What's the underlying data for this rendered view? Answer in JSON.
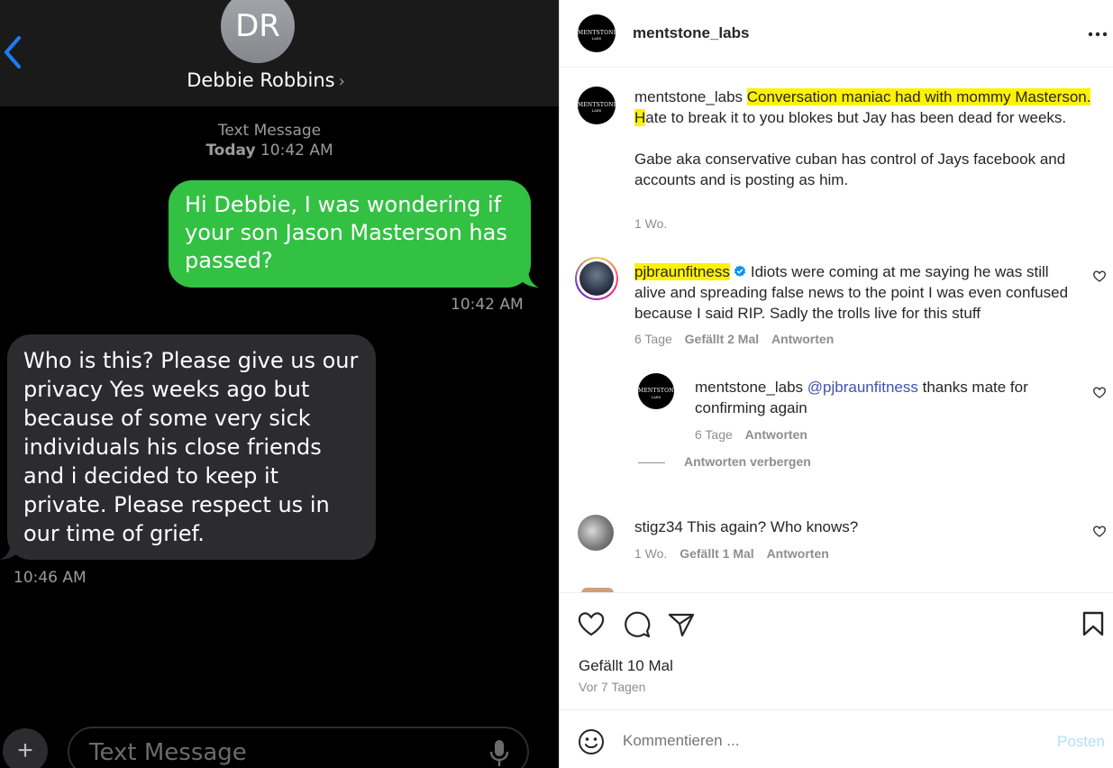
{
  "messages": {
    "contact_initials": "DR",
    "contact_name": "Debbie Robbins",
    "contact_chevron": "›",
    "meta_label": "Text Message",
    "meta_day": "Today",
    "meta_time": "10:42 AM",
    "outgoing_text": "Hi Debbie, I was wondering if your son Jason Masterson has passed?",
    "outgoing_time": "10:42 AM",
    "incoming_text": "Who is this? Please give us our privacy Yes weeks ago but because of some very sick individuals his close friends and i decided to keep it private. Please respect us in our time of grief.",
    "incoming_time": "10:46 AM",
    "add_label": "+",
    "input_placeholder": "Text Message",
    "colors": {
      "outgoing_bubble": "#33c143",
      "incoming_bubble": "#2c2c2e",
      "back_chevron": "#1e7bf3"
    }
  },
  "instagram": {
    "header_username": "mentstone_labs",
    "logo_text": "MENTSTONE",
    "logo_subtext": "LABS",
    "caption": {
      "username": "mentstone_labs",
      "highlighted": "Conversation maniac had with mommy Masterson.",
      "highlighted_tail": " H",
      "rest": "ate to break it to you blokes but Jay has been dead for weeks.",
      "paragraph2": "Gabe aka conservative cuban has control of Jays facebook and accounts and is posting as him.",
      "age": "1 Wo."
    },
    "comments": [
      {
        "username": "pjbraunfitness",
        "text": "Idiots were coming at me saying he was still alive and spreading false news to the point I was even confused because I said RIP. Sadly the trolls live for this stuff",
        "age": "6 Tage",
        "likes": "Gefällt 2 Mal",
        "reply": "Antworten"
      },
      {
        "username": "stigz34",
        "text": "This again? Who knows?",
        "age": "1 Wo.",
        "likes": "Gefällt 1 Mal",
        "reply": "Antworten"
      }
    ],
    "reply": {
      "username": "mentstone_labs",
      "mention": "@pjbraunfitness",
      "text": "thanks mate for confirming again",
      "age": "6 Tage",
      "reply": "Antworten"
    },
    "hide_replies": "Antworten verbergen",
    "likes_total": "Gefällt 10 Mal",
    "post_age": "Vor 7 Tagen",
    "comment_placeholder": "Kommentieren ...",
    "post_label": "Posten",
    "colors": {
      "highlight": "#fff200",
      "verified": "#0095f6",
      "mention": "#3f51b5",
      "post_button": "#b2dffc"
    }
  }
}
